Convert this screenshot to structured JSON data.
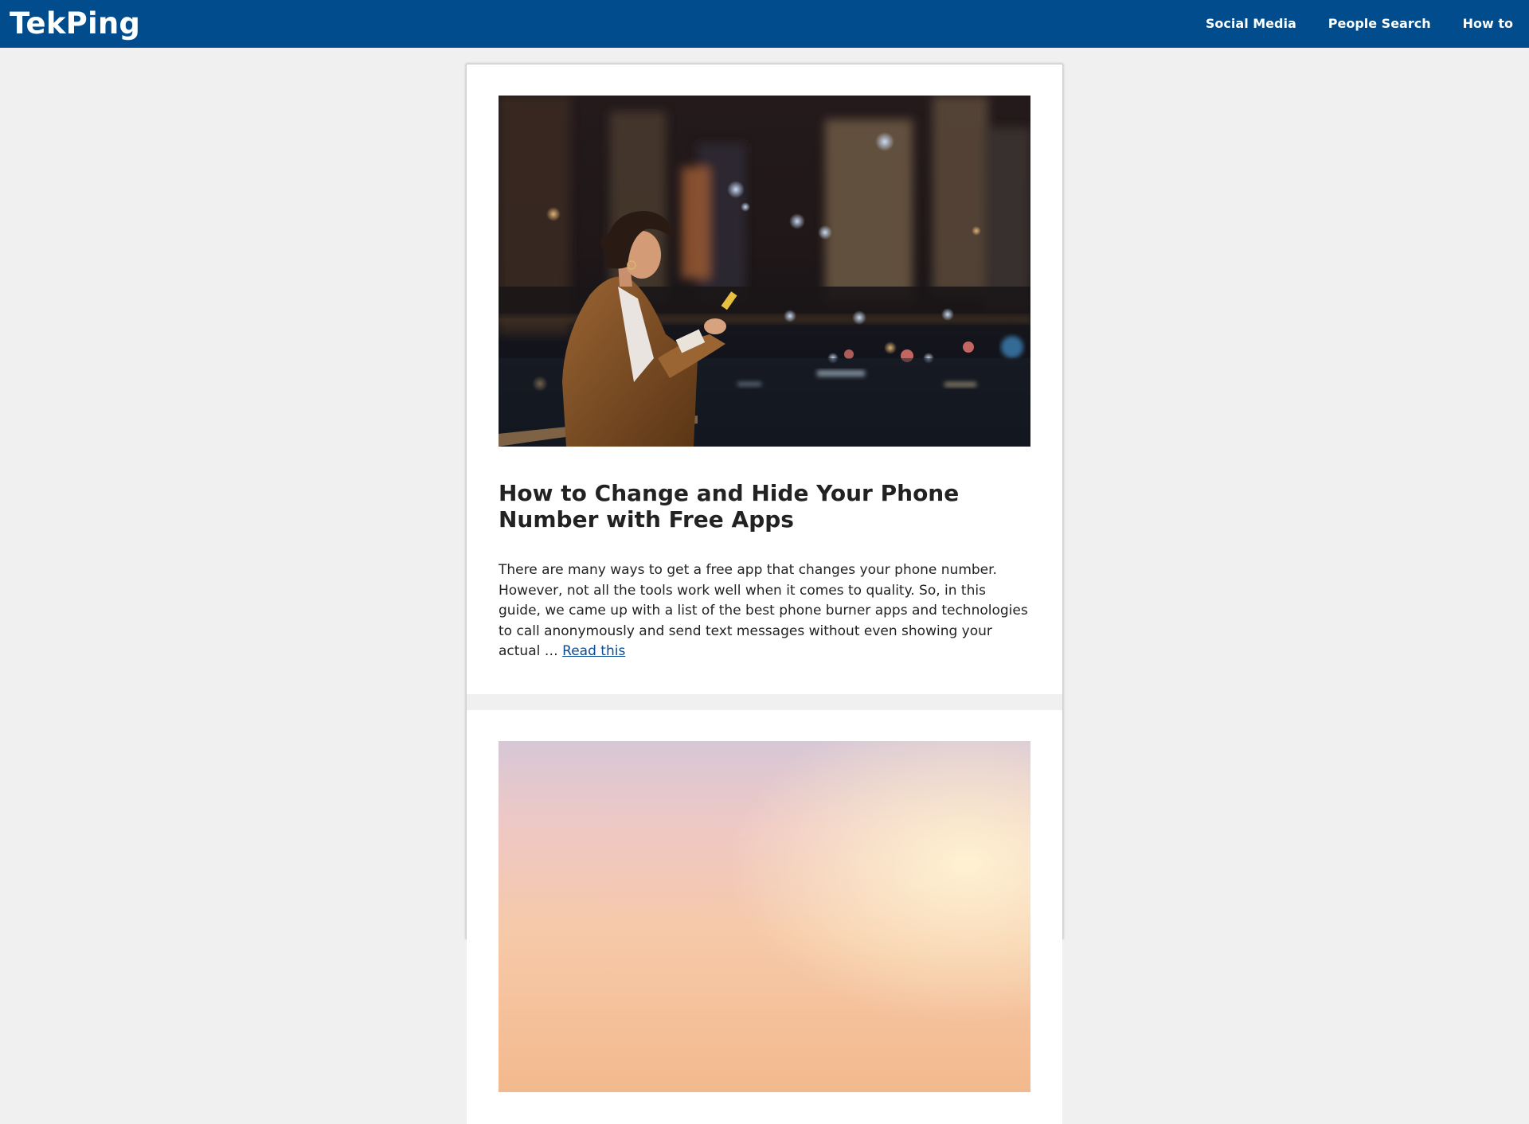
{
  "header": {
    "brand": "TekPing",
    "nav": [
      {
        "label": "Social Media"
      },
      {
        "label": "People Search"
      },
      {
        "label": "How to"
      }
    ],
    "background_color": "#004c8c"
  },
  "posts": [
    {
      "image_description": "woman in brown coat smiling at smartphone at night with city lights bokeh",
      "title": "How to Change and Hide Your Phone Number with Free Apps",
      "excerpt": "There are many ways to get a free app that changes your phone number. However, not all the tools work well when it comes to quality. So, in this guide, we came up with a list of the best phone burner apps and technologies to call anonymously and send text messages without even showing your actual …",
      "read_more": "Read this"
    },
    {
      "image_description": "pastel sunset sky"
    }
  ],
  "colors": {
    "page_background": "#f0f0f0",
    "link": "#0b4b92",
    "text": "#222222"
  }
}
